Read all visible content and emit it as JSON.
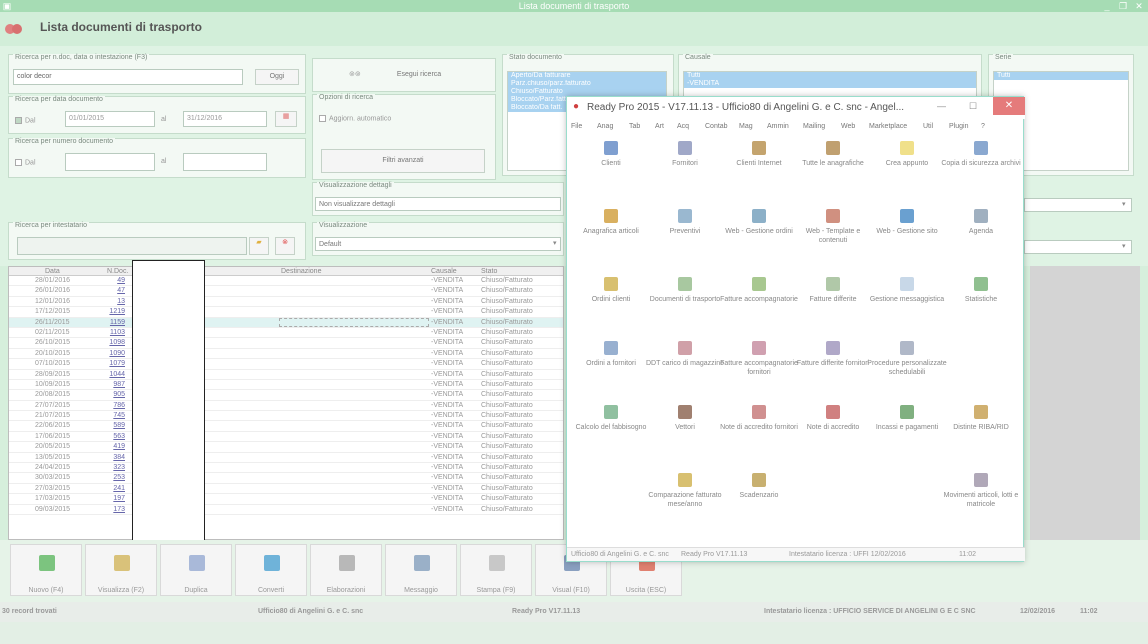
{
  "window": {
    "title": "Lista documenti di trasporto"
  },
  "header": {
    "title": "Lista documenti di trasporto"
  },
  "filters": {
    "search_legend": "Ricerca per n.doc, data o intestazione (F3)",
    "search_value": "color decor",
    "oggi_label": "Oggi",
    "date_legend": "Ricerca per data documento",
    "dal_label": "Dal",
    "date_from": "01/01/2015",
    "al_label": "al",
    "date_to": "31/12/2016",
    "number_legend": "Ricerca per numero documento",
    "num_dal_label": "Dal",
    "num_al_label": "al",
    "holder_legend": "Ricerca per intestatario",
    "execute_label": "Esegui ricerca",
    "options_legend": "Opzioni di ricerca",
    "auto_update_label": "Aggiorn. automatico",
    "advanced_filters_label": "Filtri avanzati",
    "detail_view_legend": "Visualizzazione dettagli",
    "detail_view_value": "Non visualizzare dettagli",
    "view_legend": "Visualizzazione",
    "view_value": "Default",
    "status_legend": "Stato documento",
    "status_items": [
      "Aperto/Da fatturare",
      "Parz.chiuso/parz.fatturato",
      "Chiuso/Fatturato",
      "Bloccato/Parz.fatt.",
      "Bloccato/Da fatt."
    ],
    "causale_legend": "Causale",
    "causale_items": [
      "Tutti",
      "-VENDITA"
    ],
    "serie_legend": "Serie",
    "serie_items": [
      "Tutti"
    ]
  },
  "grid": {
    "headers": {
      "data": "Data",
      "ndoc": "N.Doc.",
      "dest": "Destinazione",
      "causale": "Causale",
      "stato": "Stato"
    },
    "rows": [
      {
        "data": "28/01/2016",
        "ndoc": "49",
        "causale": "-VENDITA",
        "stato": "Chiuso/Fatturato"
      },
      {
        "data": "26/01/2016",
        "ndoc": "47",
        "causale": "-VENDITA",
        "stato": "Chiuso/Fatturato"
      },
      {
        "data": "12/01/2016",
        "ndoc": "13",
        "causale": "-VENDITA",
        "stato": "Chiuso/Fatturato"
      },
      {
        "data": "17/12/2015",
        "ndoc": "1219",
        "causale": "-VENDITA",
        "stato": "Chiuso/Fatturato"
      },
      {
        "data": "26/11/2015",
        "ndoc": "1159",
        "causale": "-VENDITA",
        "stato": "Chiuso/Fatturato"
      },
      {
        "data": "02/11/2015",
        "ndoc": "1103",
        "causale": "-VENDITA",
        "stato": "Chiuso/Fatturato"
      },
      {
        "data": "26/10/2015",
        "ndoc": "1098",
        "causale": "-VENDITA",
        "stato": "Chiuso/Fatturato"
      },
      {
        "data": "20/10/2015",
        "ndoc": "1090",
        "causale": "-VENDITA",
        "stato": "Chiuso/Fatturato"
      },
      {
        "data": "07/10/2015",
        "ndoc": "1079",
        "causale": "-VENDITA",
        "stato": "Chiuso/Fatturato"
      },
      {
        "data": "28/09/2015",
        "ndoc": "1044",
        "causale": "-VENDITA",
        "stato": "Chiuso/Fatturato"
      },
      {
        "data": "10/09/2015",
        "ndoc": "987",
        "causale": "-VENDITA",
        "stato": "Chiuso/Fatturato"
      },
      {
        "data": "20/08/2015",
        "ndoc": "905",
        "causale": "-VENDITA",
        "stato": "Chiuso/Fatturato"
      },
      {
        "data": "27/07/2015",
        "ndoc": "786",
        "causale": "-VENDITA",
        "stato": "Chiuso/Fatturato"
      },
      {
        "data": "21/07/2015",
        "ndoc": "745",
        "causale": "-VENDITA",
        "stato": "Chiuso/Fatturato"
      },
      {
        "data": "22/06/2015",
        "ndoc": "589",
        "causale": "-VENDITA",
        "stato": "Chiuso/Fatturato"
      },
      {
        "data": "17/06/2015",
        "ndoc": "563",
        "causale": "-VENDITA",
        "stato": "Chiuso/Fatturato"
      },
      {
        "data": "20/05/2015",
        "ndoc": "419",
        "causale": "-VENDITA",
        "stato": "Chiuso/Fatturato"
      },
      {
        "data": "13/05/2015",
        "ndoc": "384",
        "causale": "-VENDITA",
        "stato": "Chiuso/Fatturato"
      },
      {
        "data": "24/04/2015",
        "ndoc": "323",
        "causale": "-VENDITA",
        "stato": "Chiuso/Fatturato"
      },
      {
        "data": "30/03/2015",
        "ndoc": "253",
        "causale": "-VENDITA",
        "stato": "Chiuso/Fatturato"
      },
      {
        "data": "27/03/2015",
        "ndoc": "241",
        "causale": "-VENDITA",
        "stato": "Chiuso/Fatturato"
      },
      {
        "data": "17/03/2015",
        "ndoc": "197",
        "causale": "-VENDITA",
        "stato": "Chiuso/Fatturato"
      },
      {
        "data": "09/03/2015",
        "ndoc": "173",
        "causale": "-VENDITA",
        "stato": "Chiuso/Fatturato"
      }
    ]
  },
  "toolbar": [
    {
      "label": "Nuovo (F4)",
      "color": "#7cc47f"
    },
    {
      "label": "Visualizza (F2)",
      "color": "#d9c27a"
    },
    {
      "label": "Duplica",
      "color": "#a9b9d9"
    },
    {
      "label": "Converti",
      "color": "#6fb3d9"
    },
    {
      "label": "Elaborazioni",
      "color": "#b8b8b8"
    },
    {
      "label": "Messaggio",
      "color": "#9ab0c8"
    },
    {
      "label": "Stampa (F9)",
      "color": "#c8c8c8"
    },
    {
      "label": "Visual (F10)",
      "color": "#8aa0c0"
    },
    {
      "label": "Uscita (ESC)",
      "color": "#e08070"
    }
  ],
  "status": {
    "records": "30 record trovati",
    "company": "Ufficio80 di Angelini G. e C. snc",
    "version": "Ready Pro V17.11.13",
    "license": "Intestatario licenza : UFFICIO SERVICE DI ANGELINI G E C SNC",
    "date": "12/02/2016",
    "time": "11:02"
  },
  "popup": {
    "title": "Ready Pro 2015 - V17.11.13 - Ufficio80 di Angelini G. e C. snc - Angel...",
    "menu": [
      "File",
      "Anag",
      "Tab",
      "Art",
      "Acq",
      "Contab",
      "Mag",
      "Ammin",
      "Mailing",
      "Web",
      "Marketplace",
      "Util",
      "Plugin",
      "?"
    ],
    "items": [
      {
        "label": "Clienti",
        "color": "#7f9fd0"
      },
      {
        "label": "Fornitori",
        "color": "#a0a8c8"
      },
      {
        "label": "Clienti Internet",
        "color": "#c4a46e"
      },
      {
        "label": "Tutte le anagrafiche",
        "color": "#c0a070"
      },
      {
        "label": "Crea appunto",
        "color": "#f0e08a"
      },
      {
        "label": "Copia di sicurezza archivi",
        "color": "#8aa8d0"
      },
      {
        "label": "Anagrafica articoli",
        "color": "#d9b060"
      },
      {
        "label": "Preventivi",
        "color": "#9ab8d0"
      },
      {
        "label": "Web - Gestione ordini",
        "color": "#8cb0c8"
      },
      {
        "label": "Web - Template e contenuti",
        "color": "#d09080"
      },
      {
        "label": "Web - Gestione sito",
        "color": "#6aa0d0"
      },
      {
        "label": "Agenda",
        "color": "#a0b0c0"
      },
      {
        "label": "Ordini clienti",
        "color": "#d8c070"
      },
      {
        "label": "Documenti di trasporto",
        "color": "#a8c8a0"
      },
      {
        "label": "Fatture accompagnatorie",
        "color": "#a8c890"
      },
      {
        "label": "Fatture differite",
        "color": "#b0c8a8"
      },
      {
        "label": "Gestione messaggistica",
        "color": "#c8d8e8"
      },
      {
        "label": "Statistiche",
        "color": "#90c090"
      },
      {
        "label": "Ordini a fornitori",
        "color": "#98b0d0"
      },
      {
        "label": "DDT carico di magazzino",
        "color": "#d0a0a8"
      },
      {
        "label": "Fatture accompagnatorie fornitori",
        "color": "#d0a0b0"
      },
      {
        "label": "Fatture differite fornitori",
        "color": "#b0a8c8"
      },
      {
        "label": "Procedure personalizzate schedulabili",
        "color": "#b0b8c8"
      },
      {
        "label": "Calcolo del fabbisogno",
        "color": "#90c0a0"
      },
      {
        "label": "Vettori",
        "color": "#a08070"
      },
      {
        "label": "Note di accredito fornitori",
        "color": "#d09090"
      },
      {
        "label": "Note di accredito",
        "color": "#d08080"
      },
      {
        "label": "Incassi e pagamenti",
        "color": "#80b080"
      },
      {
        "label": "Distinte RIBA/RID",
        "color": "#d0b070"
      },
      {
        "label": "Comparazione fatturato mese/anno",
        "color": "#d8c070"
      },
      {
        "label": "Scadenzario",
        "color": "#c8b070"
      },
      {
        "label": "Movimenti articoli, lotti e matricole",
        "color": "#b0a8b8"
      }
    ],
    "status": {
      "company": "Ufficio80 di Angelini G. e C. snc",
      "version": "Ready Pro V17.11.13",
      "license": "Intestatario licenza : UFFI 12/02/2016",
      "time": "11:02"
    }
  }
}
